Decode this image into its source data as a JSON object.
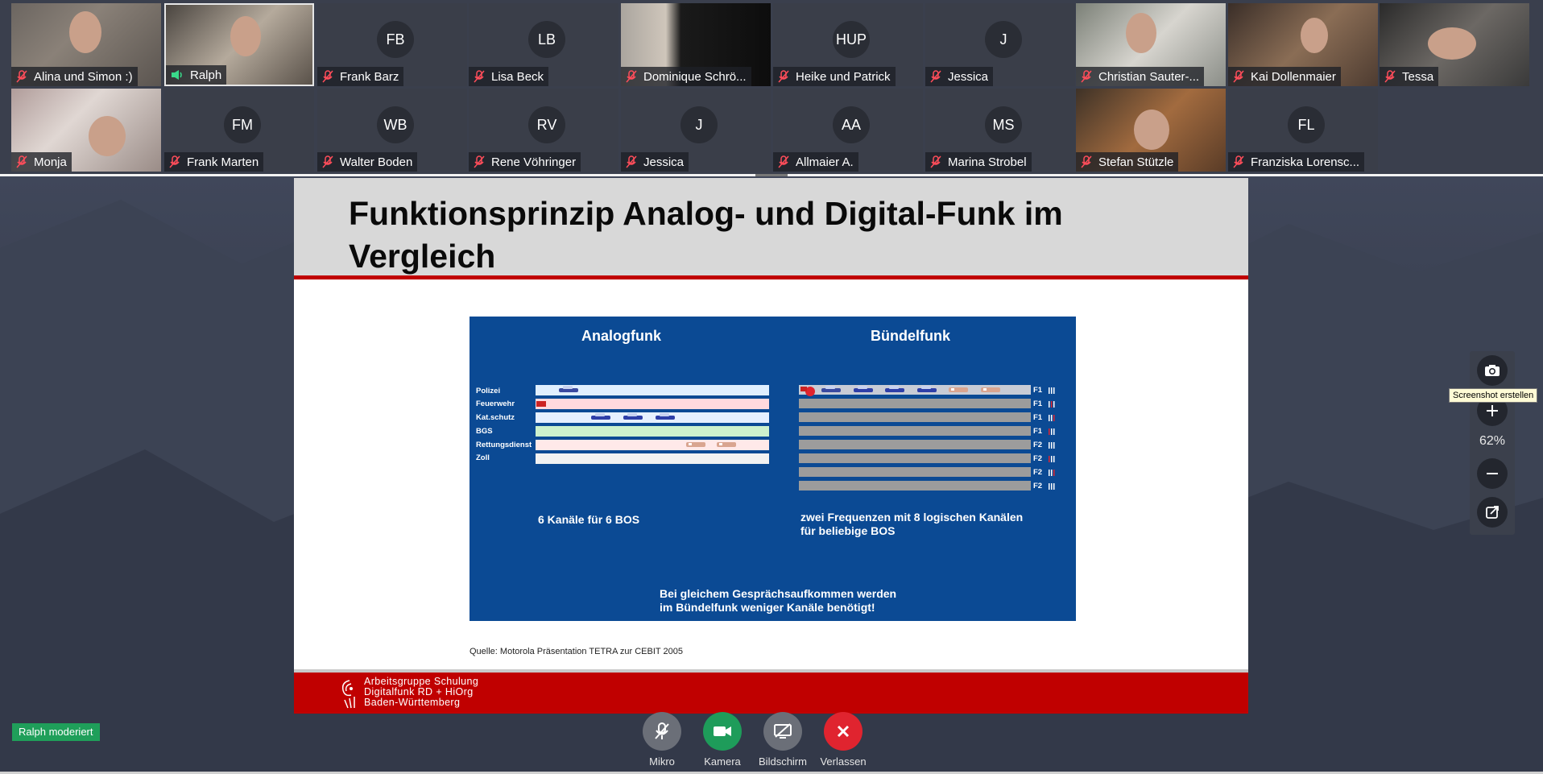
{
  "participants": [
    {
      "name": "Alina und Simon :)",
      "initials": "",
      "mic": "muted"
    },
    {
      "name": "Ralph",
      "initials": "",
      "mic": "speaking"
    },
    {
      "name": "Frank Barz",
      "initials": "FB",
      "mic": "muted"
    },
    {
      "name": "Lisa Beck",
      "initials": "LB",
      "mic": "muted"
    },
    {
      "name": "Dominique Schrö...",
      "initials": "",
      "mic": "muted"
    },
    {
      "name": "Heike und Patrick",
      "initials": "HUP",
      "mic": "muted"
    },
    {
      "name": "Jessica",
      "initials": "J",
      "mic": "muted"
    },
    {
      "name": "Christian Sauter-...",
      "initials": "",
      "mic": "muted"
    },
    {
      "name": "Kai Dollenmaier",
      "initials": "",
      "mic": "muted"
    },
    {
      "name": "Tessa",
      "initials": "",
      "mic": "muted"
    },
    {
      "name": "Monja",
      "initials": "",
      "mic": "muted"
    },
    {
      "name": "Frank Marten",
      "initials": "FM",
      "mic": "muted"
    },
    {
      "name": "Walter Boden",
      "initials": "WB",
      "mic": "muted"
    },
    {
      "name": "Rene Vöhringer",
      "initials": "RV",
      "mic": "muted"
    },
    {
      "name": "Jessica",
      "initials": "J",
      "mic": "muted"
    },
    {
      "name": "Allmaier A.",
      "initials": "AA",
      "mic": "muted"
    },
    {
      "name": "Marina Strobel",
      "initials": "MS",
      "mic": "muted"
    },
    {
      "name": "Stefan Stützle",
      "initials": "",
      "mic": "muted"
    },
    {
      "name": "Franziska Lorensc...",
      "initials": "FL",
      "mic": "muted"
    }
  ],
  "slide": {
    "title": "Funktionsprinzip Analog- und Digital-Funk im Vergleich",
    "figure": {
      "heading_left": "Analogfunk",
      "heading_right": "Bündelfunk",
      "rows": [
        "Polizei",
        "Feuerwehr",
        "Kat.schutz",
        "BGS",
        "Rettungsdienst",
        "Zoll"
      ],
      "frequency_labels": [
        "F1",
        "F1",
        "F1",
        "F1",
        "F2",
        "F2",
        "F2",
        "F2"
      ],
      "caption_left": "6 Kanäle für 6 BOS",
      "caption_right_1": "zwei Frequenzen mit 8 logischen Kanälen",
      "caption_right_2": "für beliebige BOS",
      "conclusion_1": "Bei gleichem Gesprächsaufkommen werden",
      "conclusion_2": "im Bündelfunk weniger Kanäle benötigt!"
    },
    "source": "Quelle: Motorola Präsentation TETRA zur CEBIT 2005",
    "footer_org_1": "Arbeitsgruppe  Schulung",
    "footer_org_2": "Digitalfunk RD + HiOrg",
    "footer_org_3": "Baden-Württemberg"
  },
  "side_panel": {
    "tooltip": "Screenshot erstellen",
    "zoom": "62%",
    "icons": [
      "camera-icon",
      "zoom-in-icon",
      "zoom-out-icon",
      "popout-icon"
    ]
  },
  "moderation_badge": "Ralph moderiert",
  "controls": {
    "mic_label": "Mikro",
    "camera_label": "Kamera",
    "screen_label": "Bildschirm",
    "leave_label": "Verlassen"
  },
  "colors": {
    "slide_red": "#c00000",
    "figure_blue": "#0b4a94",
    "camera_green": "#1e9c5a",
    "leave_red": "#e0242f",
    "control_gray": "#6b6f78",
    "badge_green": "#1f9f5a"
  }
}
